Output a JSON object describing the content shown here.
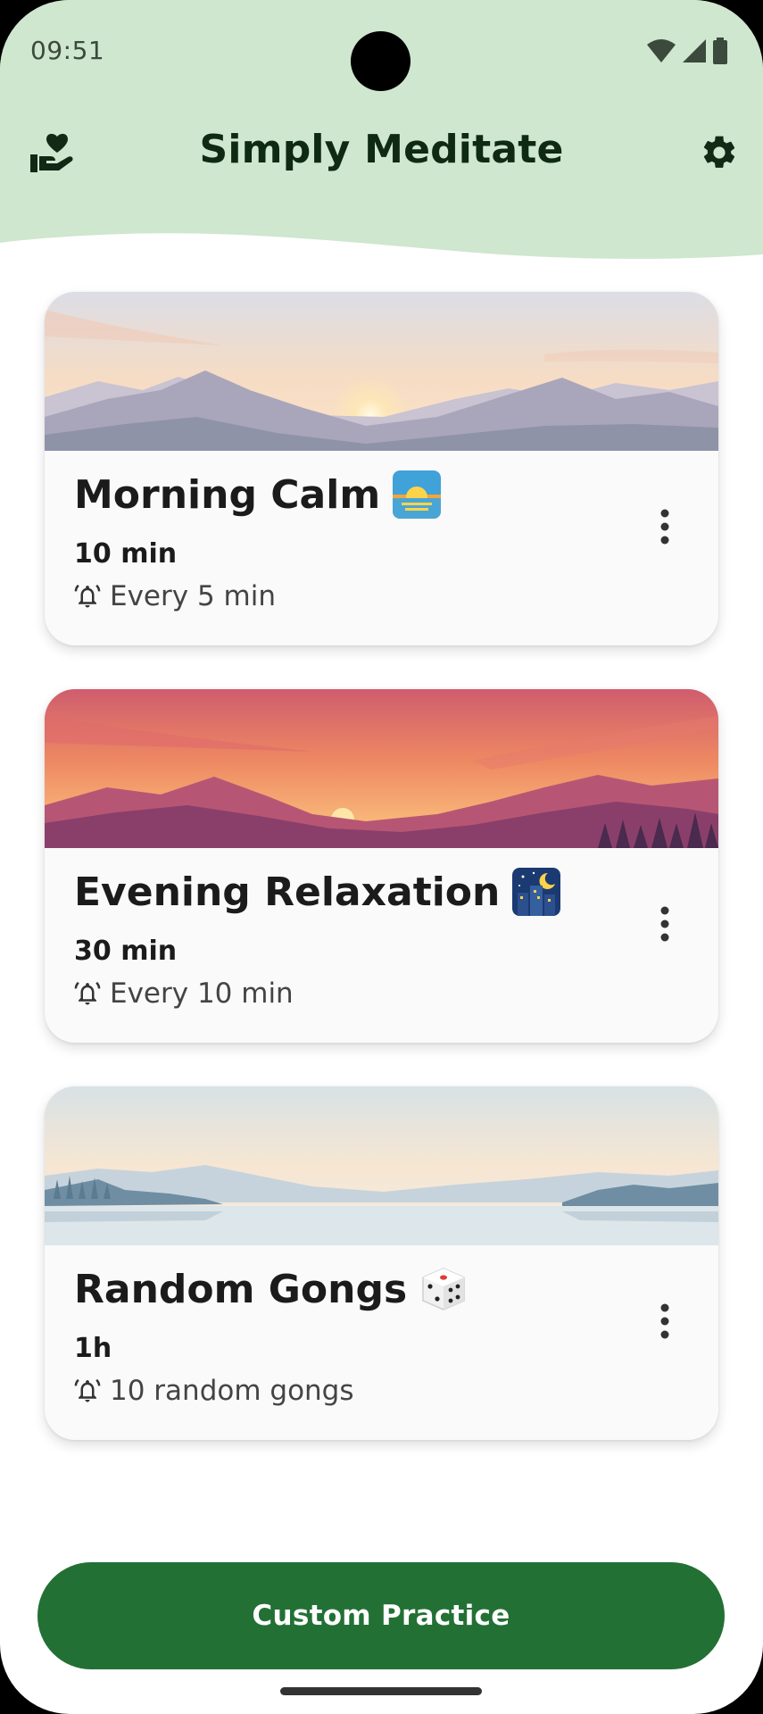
{
  "status_bar": {
    "time": "09:51"
  },
  "app_bar": {
    "title": "Simply Meditate",
    "left_icon": "donate-heart-hand-icon",
    "right_icon": "settings-gear-icon",
    "background_color": "#cfe6cf"
  },
  "practices": [
    {
      "title": "Morning Calm",
      "emoji": "sunrise",
      "duration": "10 min",
      "bell": "Every 5 min"
    },
    {
      "title": "Evening Relaxation",
      "emoji": "night-city",
      "duration": "30 min",
      "bell": "Every 10 min"
    },
    {
      "title": "Random Gongs",
      "emoji": "game-die",
      "duration": "1h",
      "bell": "10 random gongs"
    }
  ],
  "custom_button": {
    "label": "Custom Practice",
    "color": "#237035"
  }
}
